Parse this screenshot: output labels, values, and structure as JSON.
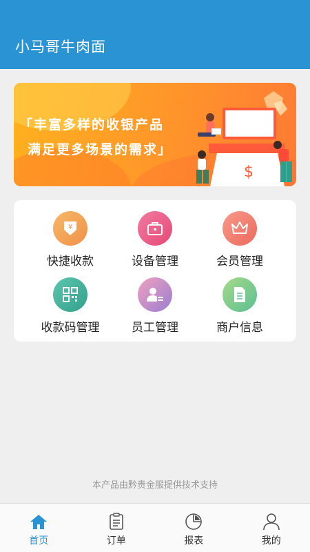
{
  "header": {
    "title": "小马哥牛肉面"
  },
  "banner": {
    "line1": "「丰富多样的收银产品",
    "line2": "满足更多场景的需求」",
    "price_symbol": "$"
  },
  "menu": [
    {
      "label": "快捷收款",
      "icon": "cash-collect-icon",
      "color": "#f5a651",
      "glyph": "¥"
    },
    {
      "label": "设备管理",
      "icon": "briefcase-icon",
      "color": "#ec5e86"
    },
    {
      "label": "会员管理",
      "icon": "crown-icon",
      "color": "#f27f6a"
    },
    {
      "label": "收款码管理",
      "icon": "qr-code-icon",
      "color": "#45b39e"
    },
    {
      "label": "员工管理",
      "icon": "staff-icon",
      "color": "#a778c8"
    },
    {
      "label": "商户信息",
      "icon": "document-icon",
      "color": "#7cc58e"
    }
  ],
  "footer_note": "本产品由黔贵金服提供技术支持",
  "tabs": [
    {
      "label": "首页",
      "icon": "home-icon",
      "active": true
    },
    {
      "label": "订单",
      "icon": "order-icon",
      "active": false
    },
    {
      "label": "报表",
      "icon": "report-icon",
      "active": false
    },
    {
      "label": "我的",
      "icon": "profile-icon",
      "active": false
    }
  ],
  "colors": {
    "header": "#2a93d3",
    "active_tab": "#2a93d3",
    "background": "#efefef"
  }
}
